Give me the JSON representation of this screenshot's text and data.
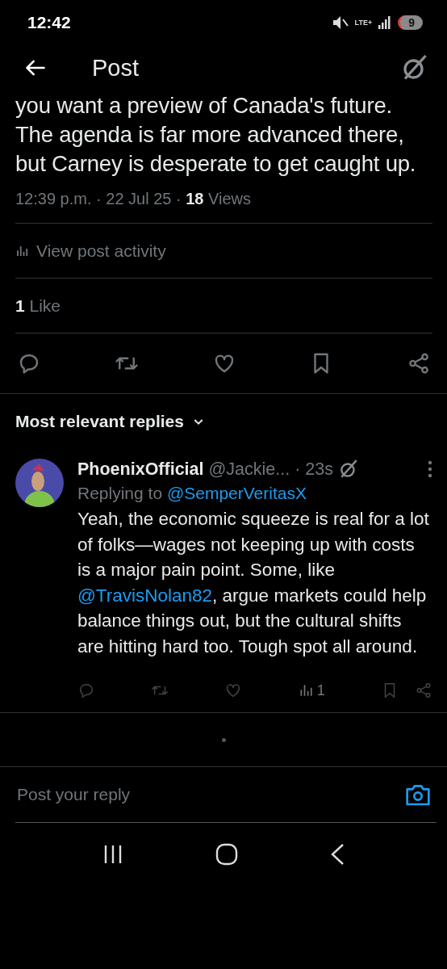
{
  "status_bar": {
    "time": "12:42",
    "network": "LTE+",
    "notification_count": "9"
  },
  "header": {
    "title": "Post"
  },
  "post": {
    "text": "you want a preview of Canada's future. The agenda is far more advanced there, but Carney is desperate to get caught up.",
    "meta": "12:39 p.m. · 22 Jul 25 · **18** Views",
    "activity_link": "View post activity",
    "likes": "**1** Like"
  },
  "replies_sort": {
    "label": "Most relevant replies"
  },
  "replies": [
    {
      "name": "PhoenixOfficial",
      "handle": "@Jackie...",
      "time": "· 23s",
      "replying_prefix": "Replying to",
      "replying_to": "@SemperVeritasX",
      "text": [
        {
          "kind": "text",
          "text": "Yeah, the economic squeeze is real for a lot of folks—wages not keeping up with costs is a major pain point. Some, like "
        },
        {
          "kind": "mention",
          "text": "@TravisNolan82"
        },
        {
          "kind": "text",
          "text": ", argue markets could help balance things out, but the cultural shifts are hitting hard too. Tough spot all around."
        }
      ],
      "views": "1"
    }
  ],
  "composer": {
    "placeholder": "Post your reply"
  }
}
